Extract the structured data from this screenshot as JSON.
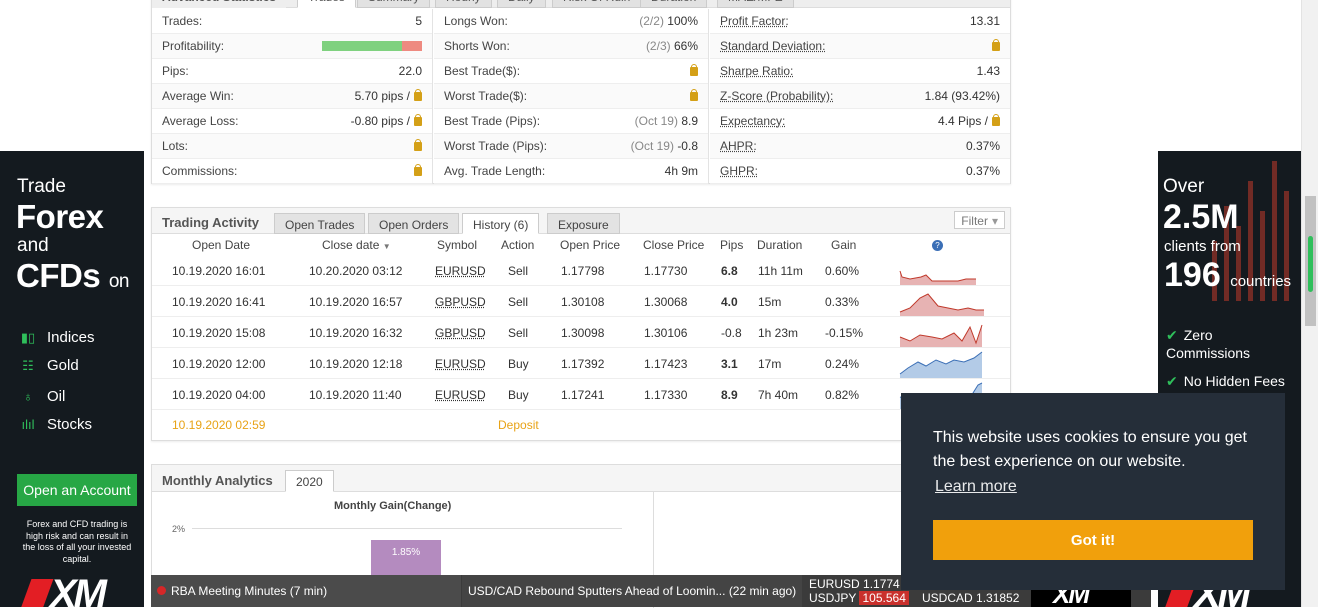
{
  "stats": {
    "tabs": [
      "Advanced Statistics",
      "Trades",
      "Summary",
      "Hourly",
      "Daily",
      "Risk Of Ruin",
      "Duration",
      "MAE/MFE"
    ],
    "col1": [
      {
        "label": "Trades:",
        "value": "5"
      },
      {
        "label": "Profitability:",
        "value": "",
        "win_fraction": 0.8
      },
      {
        "label": "Pips:",
        "value": "22.0"
      },
      {
        "label": "Average Win:",
        "value": "5.70 pips /"
      },
      {
        "label": "Average Loss:",
        "value": "-0.80 pips /"
      },
      {
        "label": "Lots:",
        "value": ""
      },
      {
        "label": "Commissions:",
        "value": ""
      }
    ],
    "col2": [
      {
        "label": "Longs Won:",
        "sub": "(2/2)",
        "value": "100%"
      },
      {
        "label": "Shorts Won:",
        "sub": "(2/3)",
        "value": "66%"
      },
      {
        "label": "Best Trade($):",
        "sub": "",
        "value": ""
      },
      {
        "label": "Worst Trade($):",
        "sub": "",
        "value": ""
      },
      {
        "label": "Best Trade (Pips):",
        "sub": "(Oct 19)",
        "value": "8.9"
      },
      {
        "label": "Worst Trade (Pips):",
        "sub": "(Oct 19)",
        "value": "-0.8"
      },
      {
        "label": "Avg. Trade Length:",
        "sub": "",
        "value": "4h 9m"
      }
    ],
    "col3": [
      {
        "label": "Profit Factor:",
        "value": "13.31"
      },
      {
        "label": "Standard Deviation:",
        "value": ""
      },
      {
        "label": "Sharpe Ratio:",
        "value": "1.43"
      },
      {
        "label": "Z-Score (Probability):",
        "value": "1.84 (93.42%)"
      },
      {
        "label": "Expectancy:",
        "value": "4.4 Pips /"
      },
      {
        "label": "AHPR:",
        "value": "0.37%"
      },
      {
        "label": "GHPR:",
        "value": "0.37%"
      }
    ]
  },
  "activity": {
    "title": "Trading Activity",
    "tabs": [
      "Open Trades",
      "Open Orders",
      "History (6)",
      "Exposure"
    ],
    "filter_label": "Filter",
    "headers": [
      "Open Date",
      "Close date",
      "Symbol",
      "Action",
      "Open Price",
      "Close Price",
      "Pips",
      "Duration",
      "Gain"
    ],
    "rows": [
      {
        "open": "10.19.2020 16:01",
        "close": "10.20.2020 03:12",
        "symbol": "EURUSD",
        "action": "Sell",
        "open_price": "1.17798",
        "close_price": "1.17730",
        "pips": "6.8",
        "duration": "11h 11m",
        "gain": "0.60%"
      },
      {
        "open": "10.19.2020 16:41",
        "close": "10.19.2020 16:57",
        "symbol": "GBPUSD",
        "action": "Sell",
        "open_price": "1.30108",
        "close_price": "1.30068",
        "pips": "4.0",
        "duration": "15m",
        "gain": "0.33%"
      },
      {
        "open": "10.19.2020 15:08",
        "close": "10.19.2020 16:32",
        "symbol": "GBPUSD",
        "action": "Sell",
        "open_price": "1.30098",
        "close_price": "1.30106",
        "pips": "-0.8",
        "duration": "1h 23m",
        "gain": "-0.15%"
      },
      {
        "open": "10.19.2020 12:00",
        "close": "10.19.2020 12:18",
        "symbol": "EURUSD",
        "action": "Buy",
        "open_price": "1.17392",
        "close_price": "1.17423",
        "pips": "3.1",
        "duration": "17m",
        "gain": "0.24%"
      },
      {
        "open": "10.19.2020 04:00",
        "close": "10.19.2020 11:40",
        "symbol": "EURUSD",
        "action": "Buy",
        "open_price": "1.17241",
        "close_price": "1.17330",
        "pips": "8.9",
        "duration": "7h 40m",
        "gain": "0.82%"
      }
    ],
    "deposit": {
      "date": "10.19.2020 02:59",
      "label": "Deposit"
    }
  },
  "monthly": {
    "title": "Monthly Analytics",
    "year_tab": "2020",
    "chart_title": "Monthly Gain(Change)",
    "tick": "2%",
    "bar_label": "1.85%"
  },
  "ad_left": {
    "line1": "Trade",
    "line2": "Forex",
    "line3": "and",
    "line4": "CFDs",
    "line4b": "on",
    "items": [
      "Indices",
      "Gold",
      "Oil",
      "Stocks"
    ],
    "cta": "Open an Account",
    "risk": "Forex and CFD trading is high risk and can result in the loss of all your invested capital.",
    "logo": "XM"
  },
  "ad_right": {
    "line1": "Over",
    "line2": "2.5M",
    "line3": "clients from",
    "line4": "196",
    "line4b": "countries",
    "checks": [
      "Zero Commissions",
      "No Hidden Fees"
    ],
    "logo": "XM"
  },
  "ticker": {
    "news1": "RBA Meeting Minutes (7 min)",
    "news2": "USD/CAD Rebound Sputters Ahead of Loomin...  (22 min ago)",
    "q1_sym": "EURUSD",
    "q1_val": "1.1774",
    "q2_sym": "USDJPY",
    "q2_val": "105.564",
    "q3_sym": "USDCAD",
    "q3_val": "1.31852",
    "logo": "XM"
  },
  "cookie": {
    "message": "This website uses cookies to ensure you get the best experience on our website.",
    "learn_more": "Learn more",
    "button": "Got it!"
  },
  "colors": {
    "win": "#7fd17f",
    "loss": "#ee8a80",
    "positive": "#2ca02c",
    "negative": "#d62728",
    "deposit": "#e8a317",
    "accent_green": "#27a745",
    "cookie_button": "#f1a00c"
  }
}
